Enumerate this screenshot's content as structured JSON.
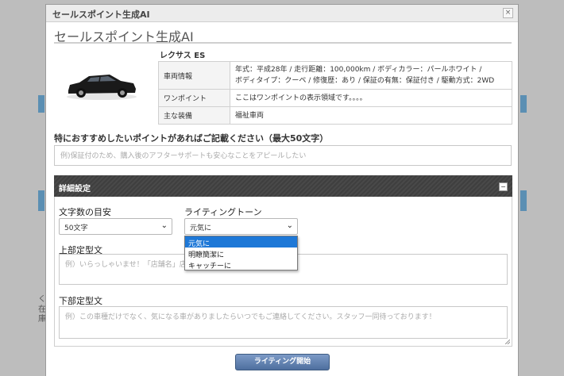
{
  "window": {
    "title": "セールスポイント生成AI",
    "close_label": "×"
  },
  "header": {
    "title": "セールスポイント生成AI"
  },
  "vehicle": {
    "name": "レクサス ES",
    "rows": [
      {
        "label": "車両情報",
        "value_line1": "年式：平成28年 / 走行距離：100,000km / ボディカラー：パールホワイト /",
        "value_line2": "ボディタイプ：クーペ / 修復歴：あり / 保証の有無：保証付き / 駆動方式：2WD"
      },
      {
        "label": "ワンポイント",
        "value_line1": "ここはワンポイントの表示領域です。。。。"
      },
      {
        "label": "主な装備",
        "value_line1": "福祉車両"
      }
    ]
  },
  "points": {
    "label": "特におすすめしたいポイントがあればご記載ください（最大50文字）",
    "placeholder": "例)保証付のため、購入後のアフターサポートも安心なことをアピールしたい"
  },
  "detail_panel": {
    "title": "詳細設定",
    "collapse_label": "−",
    "char_count": {
      "label": "文字数の目安",
      "value": "50文字"
    },
    "tone": {
      "label": "ライティングトーン",
      "value": "元気に",
      "options": [
        "元気に",
        "明瞭簡潔に",
        "キャッチーに"
      ]
    },
    "header_text": {
      "label": "上部定型文",
      "placeholder": "例）いらっしゃいませ！「店舗名」店長の"
    },
    "footer_text": {
      "label": "下部定型文",
      "placeholder": "例）この車種だけでなく、気になる車がありましたらいつでもご連絡してください。スタッフ一同待っております！"
    }
  },
  "actions": {
    "start_label": "ライティング開始"
  },
  "background": {
    "fragment1": "く",
    "fragment2": "在",
    "fragment3": "庫"
  },
  "colors": {
    "accent": "#1e78d7",
    "panel_head": "#3f3f3f",
    "button": "#5a7bab"
  }
}
